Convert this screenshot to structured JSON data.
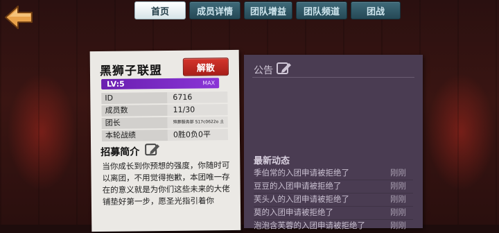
{
  "tabs": [
    {
      "label": "首页",
      "active": true
    },
    {
      "label": "成员详情",
      "active": false
    },
    {
      "label": "团队增益",
      "active": false
    },
    {
      "label": "团队频道",
      "active": false
    },
    {
      "label": "团战",
      "active": false
    }
  ],
  "guild": {
    "name": "黑狮子联盟",
    "dissolve_label": "解散",
    "level_text": "LV:5",
    "level_max": "MAX",
    "info": [
      {
        "key": "ID",
        "value": "6716"
      },
      {
        "key": "成员数",
        "value": "11/30"
      },
      {
        "key": "团长",
        "value": "殡葬服务部 S17c0622o 土肆"
      },
      {
        "key": "本轮战绩",
        "value": "0胜0负0平"
      }
    ],
    "recruit_title": "招募简介",
    "recruit_text": "当你成长到你预想的强度，你随时可以离团，不用觉得抱歉，本团唯一存在的意义就是为你们这些未来的大佬铺垫好第一步，愿圣光指引着你"
  },
  "panel": {
    "notice_label": "公告",
    "news_title": "最新动态",
    "news": [
      {
        "text": "季伯常的入团申请被拒绝了",
        "time": "刚刚"
      },
      {
        "text": "豆豆的入团申请被拒绝了",
        "time": "刚刚"
      },
      {
        "text": "芙头人的入团申请被拒绝了",
        "time": "刚刚"
      },
      {
        "text": "莫的入团申请被拒绝了",
        "time": "刚刚"
      },
      {
        "text": "泡泡含芙蓉的入团申请被拒绝了",
        "time": "刚刚"
      }
    ]
  },
  "colors": {
    "tab_active": "#ffffff",
    "tab_inactive": "#2f5866",
    "dissolve": "#c42a22",
    "level_bar": "#7b2cc7",
    "panel": "#4a3c52"
  },
  "icons": {
    "back": "back-arrow-icon",
    "edit": "pencil-icon"
  }
}
